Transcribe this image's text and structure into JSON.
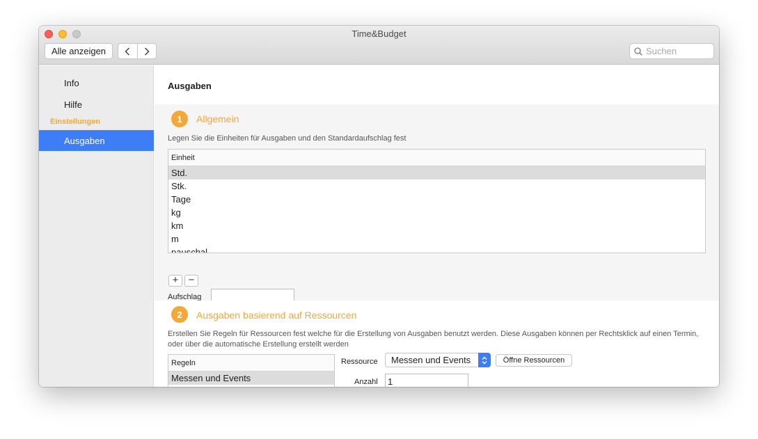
{
  "window": {
    "title": "Time&Budget"
  },
  "toolbar": {
    "show_all_label": "Alle anzeigen",
    "search_placeholder": "Suchen"
  },
  "sidebar": {
    "items": [
      {
        "label": "Info"
      },
      {
        "label": "Hilfe"
      }
    ],
    "section_header": "Einstellungen",
    "selected_item": {
      "label": "Ausgaben"
    }
  },
  "main": {
    "page_title": "Ausgaben",
    "section1": {
      "number": "1",
      "title": "Allgemein",
      "description": "Legen Sie die Einheiten für Ausgaben und den Standardaufschlag fest",
      "table_header": "Einheit",
      "units": [
        "Std.",
        "Stk.",
        "Tage",
        "kg",
        "km",
        "m",
        "pauschal"
      ],
      "add_label": "+",
      "remove_label": "−",
      "surcharge_label": "Aufschlag",
      "surcharge_value": ""
    },
    "section2": {
      "number": "2",
      "title": "Ausgaben basierend auf Ressourcen",
      "description": "Erstellen Sie Regeln für Ressourcen fest welche für die Erstellung von Ausgaben benutzt werden. Diese Ausgaben können per Rechtsklick auf einen Termin, oder über die automatische Erstellung erstellt werden",
      "rules_header": "Regeln",
      "rules": [
        "Messen und Events"
      ],
      "resource_label": "Ressource",
      "resource_value": "Messen und Events",
      "open_resources_label": "Öffne Ressourcen",
      "count_label": "Anzahl",
      "count_value": "1"
    }
  },
  "colors": {
    "accent": "#f3a837",
    "selection": "#3d7df6"
  }
}
